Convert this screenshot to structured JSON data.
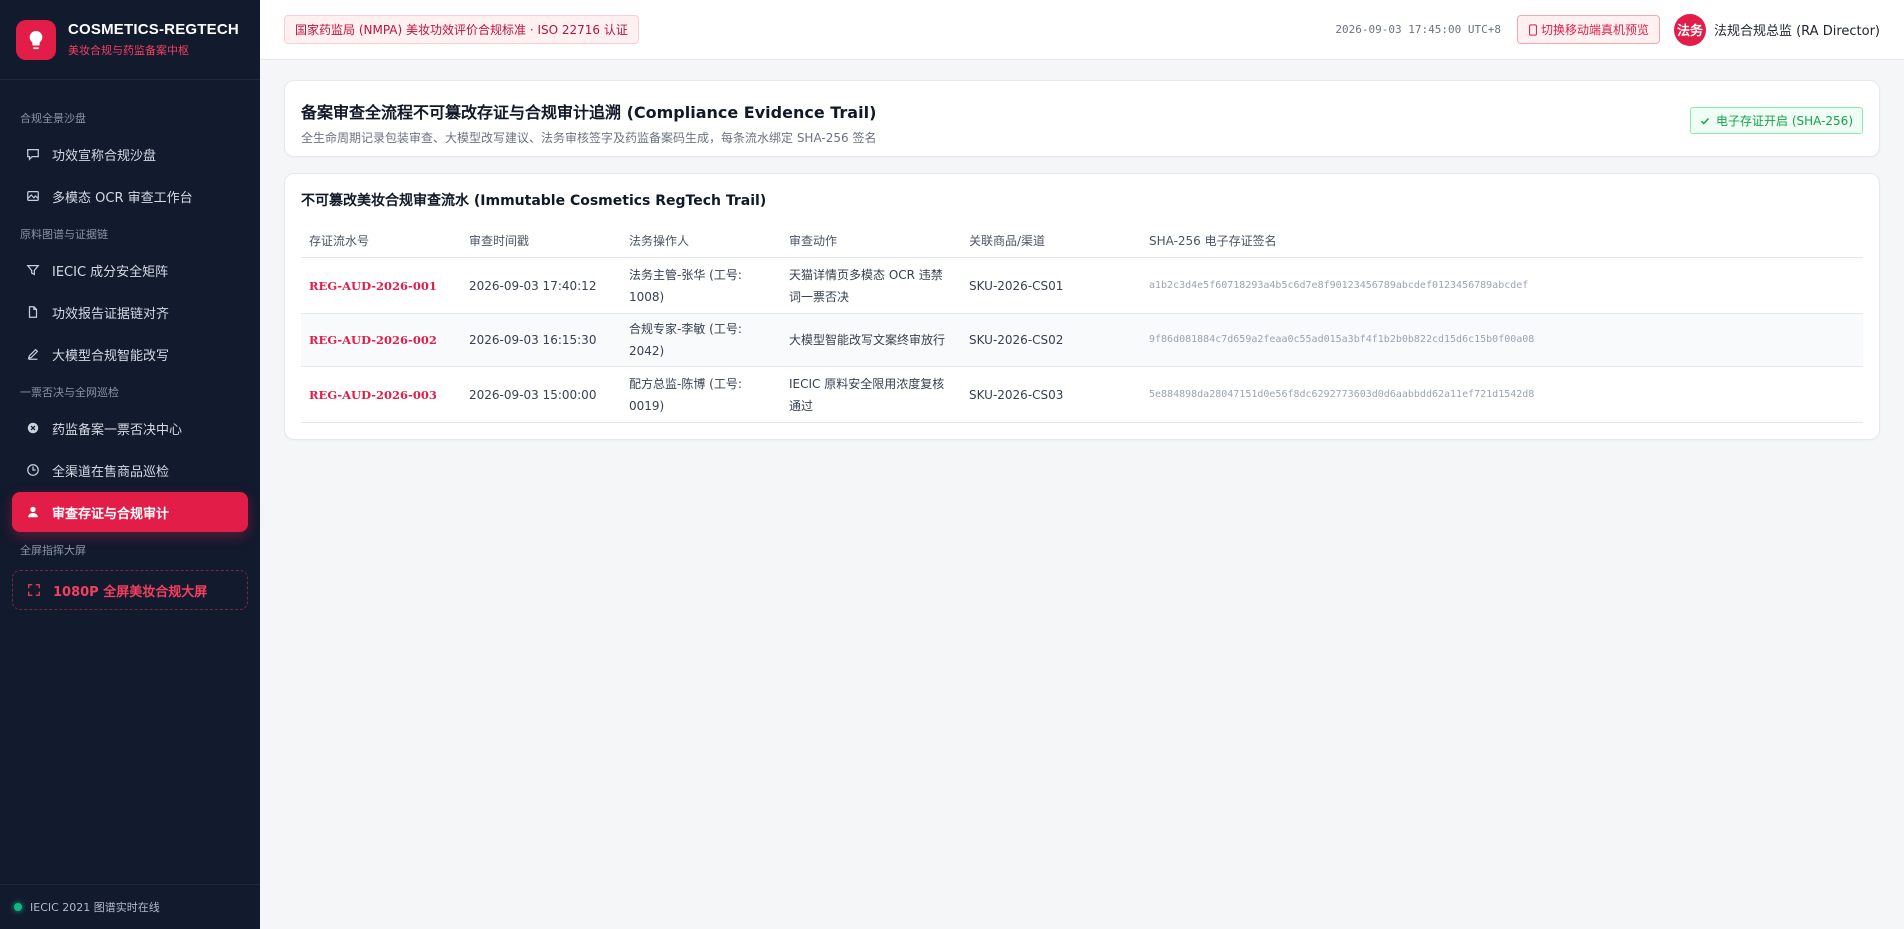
{
  "brand": {
    "title": "COSMETICS-REGTECH",
    "subtitle": "美妆合规与药监备案中枢"
  },
  "sidebar": {
    "sections": [
      {
        "label": "合规全景沙盘"
      },
      {
        "label": "原料图谱与证据链"
      },
      {
        "label": "一票否决与全网巡检"
      },
      {
        "label": "全屏指挥大屏"
      }
    ],
    "items": [
      {
        "label": "功效宣称合规沙盘",
        "icon": "chat-icon"
      },
      {
        "label": "多模态 OCR 审查工作台",
        "icon": "image-icon"
      },
      {
        "label": "IECIC 成分安全矩阵",
        "icon": "filter-icon"
      },
      {
        "label": "功效报告证据链对齐",
        "icon": "document-icon"
      },
      {
        "label": "大模型合规智能改写",
        "icon": "pen-icon"
      },
      {
        "label": "药监备案一票否决中心",
        "icon": "x-circle-icon"
      },
      {
        "label": "全渠道在售商品巡检",
        "icon": "clock-icon"
      },
      {
        "label": "审查存证与合规审计",
        "icon": "user-icon"
      },
      {
        "label": "1080P 全屏美妆合规大屏",
        "icon": "expand-icon"
      }
    ],
    "footer": "IECIC 2021 图谱实时在线"
  },
  "topbar": {
    "standard_badge": "国家药监局 (NMPA) 美妆功效评价合规标准 · ISO 22716 认证",
    "clock": "2026-09-03 17:45:00 UTC+8",
    "mobile_button": "切换移动端真机预览",
    "avatar_text": "法务",
    "user_name": "法规合规总监 (RA Director)"
  },
  "header": {
    "title": "备案审查全流程不可篡改存证与合规审计追溯 (Compliance Evidence Trail)",
    "subtitle": "全生命周期记录包装审查、大模型改写建议、法务审核签字及药监备案码生成，每条流水绑定 SHA-256 签名",
    "badge": "电子存证开启 (SHA-256)"
  },
  "trail": {
    "title": "不可篡改美妆合规审查流水 (Immutable Cosmetics RegTech Trail)",
    "columns": [
      "存证流水号",
      "审查时间戳",
      "法务操作人",
      "审查动作",
      "关联商品/渠道",
      "SHA-256 电子存证签名"
    ],
    "rows": [
      {
        "id": "REG-AUD-2026-001",
        "time": "2026-09-03 17:40:12",
        "operator": "法务主管-张华 (工号: 1008)",
        "action": "天猫详情页多模态 OCR 违禁词一票否决",
        "sku": "SKU-2026-CS01",
        "sig": "a1b2c3d4e5f60718293a4b5c6d7e8f90123456789abcdef0123456789abcdef"
      },
      {
        "id": "REG-AUD-2026-002",
        "time": "2026-09-03 16:15:30",
        "operator": "合规专家-李敏 (工号: 2042)",
        "action": "大模型智能改写文案终审放行",
        "sku": "SKU-2026-CS02",
        "sig": "9f86d081884c7d659a2feaa0c55ad015a3bf4f1b2b0b822cd15d6c15b0f00a08"
      },
      {
        "id": "REG-AUD-2026-003",
        "time": "2026-09-03 15:00:00",
        "operator": "配方总监-陈博 (工号: 0019)",
        "action": "IECIC 原料安全限用浓度复核通过",
        "sku": "SKU-2026-CS03",
        "sig": "5e884898da28047151d0e56f8dc6292773603d0d6aabbdd62a11ef721d1542d8"
      }
    ]
  },
  "colors": {
    "accent": "#e11d48",
    "sidebar_bg": "#121a2e",
    "success": "#16a34a"
  }
}
